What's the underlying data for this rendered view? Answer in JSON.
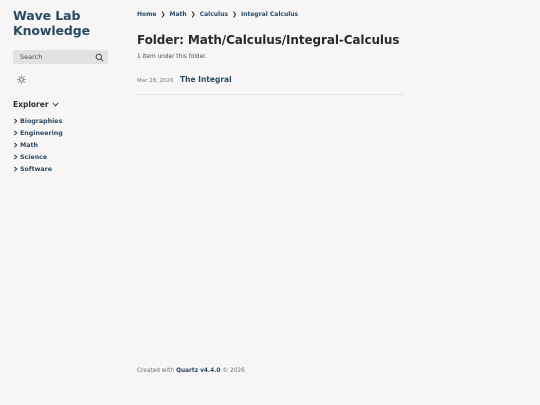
{
  "site": {
    "title": "Wave Lab Knowledge"
  },
  "search": {
    "placeholder": "Search"
  },
  "icons": {
    "search": "search-icon",
    "theme": "sun-icon",
    "explorer_toggle": "chevron-down-icon",
    "folder": "chevron-right-icon"
  },
  "explorer": {
    "title": "Explorer",
    "items": [
      {
        "label": "Biographies"
      },
      {
        "label": "Engineering"
      },
      {
        "label": "Math"
      },
      {
        "label": "Science"
      },
      {
        "label": "Software"
      }
    ]
  },
  "breadcrumb": [
    {
      "label": "Home"
    },
    {
      "label": "Math"
    },
    {
      "label": "Calculus"
    },
    {
      "label": "Integral Calculus"
    }
  ],
  "breadcrumb_separator": "❯",
  "main": {
    "title": "Folder: Math/Calculus/Integral-Calculus",
    "count_text": "1 item under this folder.",
    "entries": [
      {
        "date": "Mar 28, 2026",
        "title": "The Integral"
      }
    ]
  },
  "footer": {
    "prefix": "Created with",
    "link": "Quartz v4.4.0",
    "suffix": "© 2026"
  },
  "colors": {
    "background": "#f7f5f6",
    "accent": "#284b63",
    "search_bg": "#e3e1e2"
  }
}
